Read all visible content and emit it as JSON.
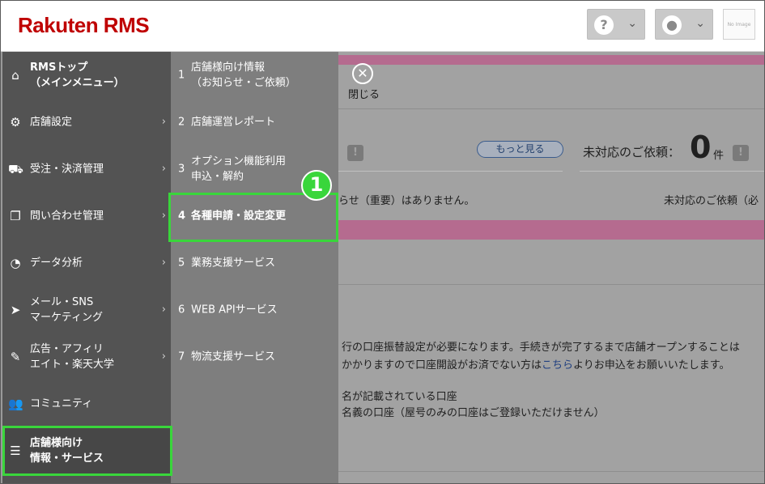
{
  "header": {
    "logo": "Rakuten RMS",
    "help_icon": "question-icon",
    "user_icon": "user-icon",
    "no_image": "No Image"
  },
  "sidebar": {
    "items": [
      {
        "label": "RMSトップ\n（メインメニュー）",
        "icon": "home-icon",
        "bold": true
      },
      {
        "label": "店舗設定",
        "icon": "gear-icon"
      },
      {
        "label": "受注・決済管理",
        "icon": "cart-icon"
      },
      {
        "label": "問い合わせ管理",
        "icon": "chat-icon"
      },
      {
        "label": "データ分析",
        "icon": "pie-chart-icon"
      },
      {
        "label": "メール・SNS\nマーケティング",
        "icon": "paper-plane-icon"
      },
      {
        "label": "広告・アフィリ\nエイト・楽天大学",
        "icon": "megaphone-icon"
      },
      {
        "label": "コミュニティ",
        "icon": "people-icon"
      },
      {
        "label": "店舗様向け\n情報・サービス",
        "icon": "list-icon",
        "bold": true
      }
    ]
  },
  "submenu": {
    "items": [
      {
        "num": "1",
        "label": "店舗様向け情報\n（お知らせ・ご依頼）"
      },
      {
        "num": "2",
        "label": "店舗運営レポート"
      },
      {
        "num": "3",
        "label": "オプション機能利用\n申込・解約"
      },
      {
        "num": "4",
        "label": "各種申請・設定変更"
      },
      {
        "num": "5",
        "label": "業務支援サービス"
      },
      {
        "num": "6",
        "label": "WEB APIサービス"
      },
      {
        "num": "7",
        "label": "物流支援サービス"
      }
    ]
  },
  "annotation": {
    "step_number": "1"
  },
  "main": {
    "close_label": "閉じる",
    "more_button": "もっと見る",
    "pending_label": "未対応のご依頼：",
    "pending_count": "0",
    "pending_unit": "件",
    "notice_text": "らせ（重要）はありません。",
    "pending_cut": "未対応のご依頼（必",
    "para1_line1": "行の口座振替設定が必要になります。手続きが完了するまで店舗オープンすることは",
    "para1_line2_a": "かかりますので口座開設がお済でない方は",
    "para1_link": "こちら",
    "para1_line2_b": "よりお申込をお願いいたします。",
    "para2_line1": "名が記載されている口座",
    "para2_line2": "名義の口座（屋号のみの口座はご登録いただけません）"
  }
}
